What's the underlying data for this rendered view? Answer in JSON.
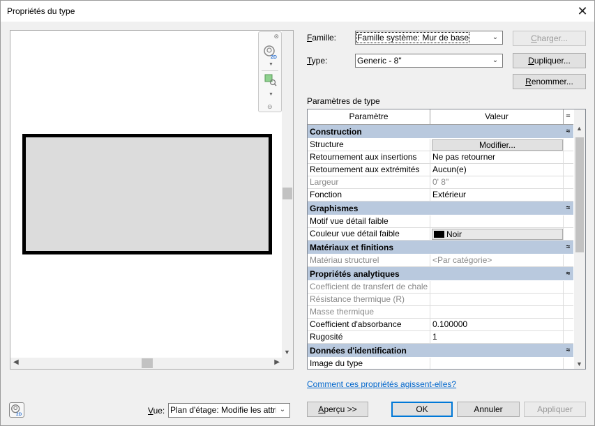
{
  "window": {
    "title": "Propriétés du type",
    "close_glyph": "✕"
  },
  "preview": {
    "nav_close": "⊗",
    "nav_grip": "⊖",
    "nav_icon1": "zoom-2d-icon",
    "nav_icon2": "zoom-region-icon"
  },
  "family": {
    "label_u": "F",
    "label_rest": "amille:",
    "value": "Famille système: Mur de base"
  },
  "type": {
    "label_u": "T",
    "label_rest": "ype:",
    "value": "Generic - 8\""
  },
  "buttons": {
    "load_u": "C",
    "load_rest": "harger...",
    "duplicate_u": "D",
    "duplicate_rest": "upliquer...",
    "rename_u": "R",
    "rename_rest": "enommer..."
  },
  "params_title": "Paramètres de type",
  "grid": {
    "col_param": "Paramètre",
    "col_value": "Valeur",
    "sort_glyph": "="
  },
  "groups": [
    {
      "title": "Construction",
      "rows": [
        {
          "param": "Structure",
          "value": "Modifier...",
          "kind": "button"
        },
        {
          "param": "Retournement aux insertions",
          "value": "Ne pas retourner"
        },
        {
          "param": "Retournement aux extrémités",
          "value": "Aucun(e)"
        },
        {
          "param": "Largeur",
          "value": "0'  8\"",
          "disabled": true
        },
        {
          "param": "Fonction",
          "value": "Extérieur"
        }
      ]
    },
    {
      "title": "Graphismes",
      "rows": [
        {
          "param": "Motif vue détail faible",
          "value": ""
        },
        {
          "param": "Couleur vue détail faible",
          "value": "Noir",
          "kind": "color",
          "color": "#000000"
        }
      ]
    },
    {
      "title": "Matériaux et finitions",
      "rows": [
        {
          "param": "Matériau structurel",
          "value": "<Par catégorie>",
          "disabled": true
        }
      ]
    },
    {
      "title": "Propriétés analytiques",
      "rows": [
        {
          "param": "Coefficient de transfert de chale",
          "value": "",
          "disabled": true
        },
        {
          "param": "Résistance thermique (R)",
          "value": "",
          "disabled": true
        },
        {
          "param": "Masse thermique",
          "value": "",
          "disabled": true
        },
        {
          "param": "Coefficient d'absorbance",
          "value": "0.100000"
        },
        {
          "param": "Rugosité",
          "value": "1"
        }
      ]
    },
    {
      "title": "Données d'identification",
      "rows": [
        {
          "param": "Image du type",
          "value": ""
        }
      ]
    }
  ],
  "collapse_glyph": "≈",
  "help_link": "Comment ces propriétés agissent-elles?",
  "footer": {
    "view_label_u": "V",
    "view_label_rest": "ue:",
    "view_value": "Plan d'étage: Modifie les attribu",
    "preview_u": "A",
    "preview_rest": "perçu >>",
    "ok": "OK",
    "cancel": "Annuler",
    "apply": "Appliquer"
  }
}
